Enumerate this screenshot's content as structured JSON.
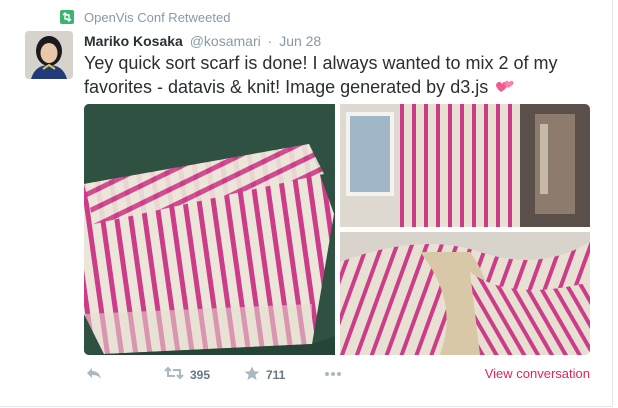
{
  "context": {
    "text": "OpenVis Conf Retweeted",
    "icon": "retweet-badge-icon"
  },
  "tweet": {
    "fullname": "Mariko Kosaka",
    "username": "@kosamari",
    "separator": "·",
    "time": "Jun 28",
    "text": "Yey quick sort scarf is done!  I always wanted to mix 2 of my favorites - datavis & knit! Image generated by d3.js",
    "emoji": "two-hearts-icon"
  },
  "media": {
    "photos": [
      "knit-scarf-folded-photo",
      "knit-scarf-hanging-photo",
      "knit-scarf-worn-photo"
    ]
  },
  "actions": {
    "reply_icon": "reply-icon",
    "retweet_icon": "retweet-icon",
    "retweet_count": "395",
    "favorite_icon": "star-icon",
    "favorite_count": "711",
    "more_icon": "more-dots-icon",
    "view_conversation": "View conversation"
  },
  "colors": {
    "accent": "#e0245e",
    "retweet_badge": "#3cb371",
    "muted": "#8899a6",
    "text": "#292f33"
  }
}
